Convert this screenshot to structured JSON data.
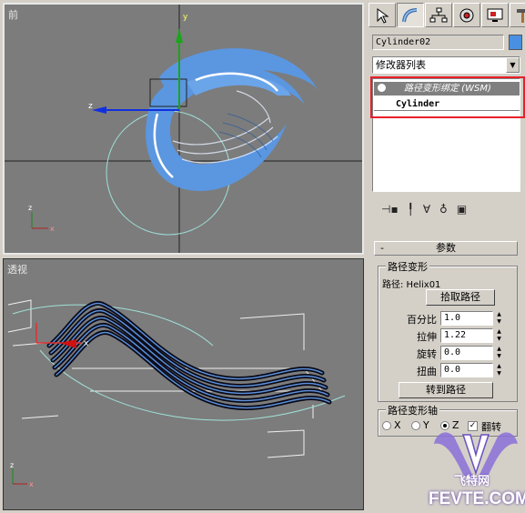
{
  "viewports": {
    "front": {
      "label": "前"
    },
    "perspective": {
      "label": "透视"
    }
  },
  "command_panel": {
    "tabs": [
      {
        "icon": "create-cursor-icon"
      },
      {
        "icon": "modify-bend-icon"
      },
      {
        "icon": "hierarchy-icon"
      },
      {
        "icon": "motion-icon"
      },
      {
        "icon": "display-monitor-icon"
      },
      {
        "icon": "utilities-hammer-icon"
      }
    ],
    "object_name": "Cylinder02",
    "object_color": "#4a90e2",
    "modifier_list": "修改器列表",
    "stack": {
      "wsm_item": "路径变形绑定 (WSM)",
      "base_item": "Cylinder"
    },
    "rollout": {
      "title": "参数",
      "minus": "-",
      "path_deform": {
        "title": "路径变形",
        "path_text": "路径: Helix01",
        "pick_path": "拾取路径",
        "percent": {
          "label": "百分比",
          "value": "1.0"
        },
        "stretch": {
          "label": "拉伸",
          "value": "1.22"
        },
        "rotation": {
          "label": "旋转",
          "value": "0.0"
        },
        "twist": {
          "label": "扭曲",
          "value": "0.0"
        },
        "move_to_path": "转到路径"
      },
      "axis": {
        "title": "路径变形轴",
        "x": "X",
        "y": "Y",
        "z": "Z",
        "flip": "翻转"
      }
    }
  },
  "watermark": {
    "site": "飞特网",
    "domain": "FEVTE.COM"
  },
  "axis_labels": {
    "x": "x",
    "y": "y",
    "z": "z"
  }
}
